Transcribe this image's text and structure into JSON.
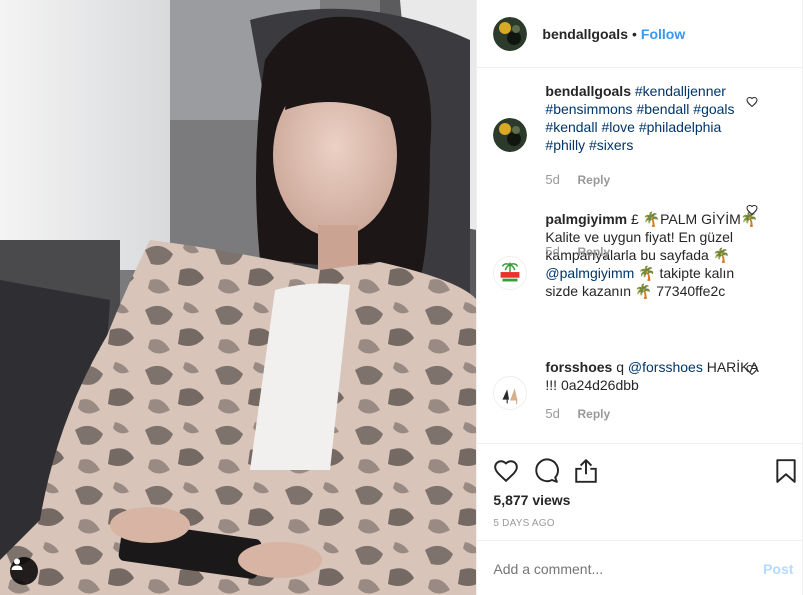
{
  "post": {
    "username": "bendallgoals",
    "separator": "•",
    "follow_label": "Follow",
    "views": "5,877 views",
    "date": "5 DAYS AGO",
    "add_comment_placeholder": "Add a comment...",
    "post_label": "Post"
  },
  "caption": {
    "username": "bendallgoals",
    "hashtags": [
      "#kendalljenner",
      "#bensimmons",
      "#bendall",
      "#goals",
      "#kendall",
      "#love",
      "#philadelphia",
      "#philly",
      "#sixers"
    ],
    "time": "5d",
    "reply_label": "Reply"
  },
  "comments": [
    {
      "username": "palmgiyimm",
      "line1": "£ 🌴PALM GİYİM🌴",
      "line2": "Kalite ve uygun fiyat! En güzel",
      "line3": "kampanyalarla bu sayfada 🌴",
      "mention": "@palmgiyimm",
      "line4": " 🌴 takipte kalın",
      "line5": "sizde kazanın 🌴 77340ffe2c",
      "time": "5d",
      "reply_label": "Reply",
      "avatar_text": "PALM"
    },
    {
      "username": "forsshoes",
      "prefix": " q ",
      "mention": "@forsshoes",
      "line1_rest": " HARİKA",
      "line2": "!!! 0a24d26dbb",
      "time": "5d",
      "reply_label": "Reply"
    }
  ],
  "icons": {
    "like": "heart-icon",
    "comment": "comment-icon",
    "share": "share-icon",
    "save": "bookmark-icon",
    "tag": "user-tag-icon"
  },
  "colors": {
    "link_blue": "#3897f0",
    "hashtag": "#003569",
    "muted": "#999999",
    "post_disabled": "#b3dbff"
  }
}
